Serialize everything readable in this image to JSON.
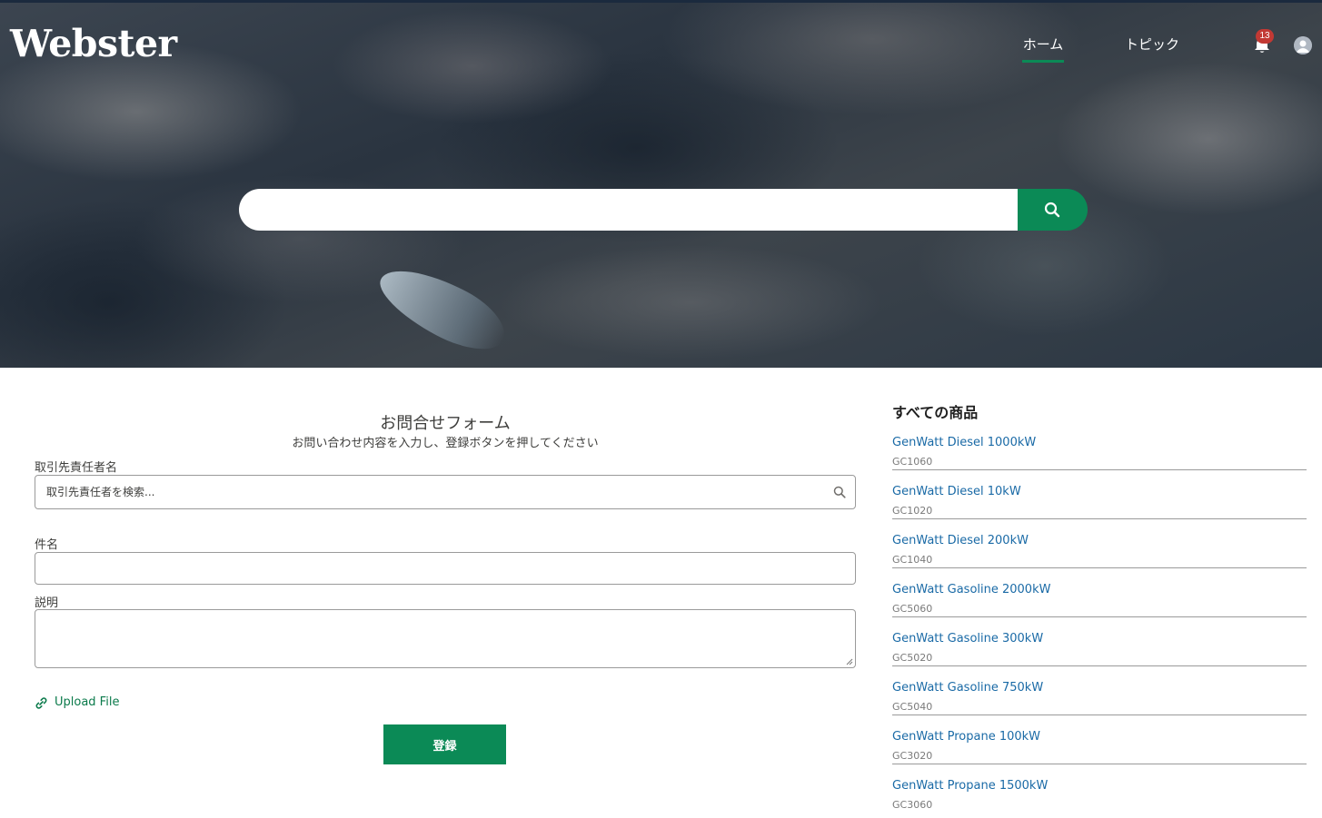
{
  "header": {
    "logo": "Webster",
    "nav": [
      {
        "label": "ホーム",
        "active": true
      },
      {
        "label": "トピック",
        "active": false
      }
    ],
    "notifications_count": "13",
    "accent_color": "#0b8a56"
  },
  "search": {
    "placeholder": "",
    "button_icon": "search-icon"
  },
  "form": {
    "title": "お問合せフォーム",
    "subtitle": "お問い合わせ内容を入力し、登録ボタンを押してください",
    "contact_label": "取引先責任者名",
    "contact_placeholder": "取引先責任者を検索...",
    "subject_label": "件名",
    "subject_value": "",
    "description_label": "説明",
    "description_value": "",
    "upload_label": "Upload File",
    "submit_label": "登録"
  },
  "products": {
    "title": "すべての商品",
    "items": [
      {
        "name": "GenWatt Diesel 1000kW",
        "code": "GC1060"
      },
      {
        "name": "GenWatt Diesel 10kW",
        "code": "GC1020"
      },
      {
        "name": "GenWatt Diesel 200kW",
        "code": "GC1040"
      },
      {
        "name": "GenWatt Gasoline 2000kW",
        "code": "GC5060"
      },
      {
        "name": "GenWatt Gasoline 300kW",
        "code": "GC5020"
      },
      {
        "name": "GenWatt Gasoline 750kW",
        "code": "GC5040"
      },
      {
        "name": "GenWatt Propane 100kW",
        "code": "GC3020"
      },
      {
        "name": "GenWatt Propane 1500kW",
        "code": "GC3060"
      }
    ]
  }
}
